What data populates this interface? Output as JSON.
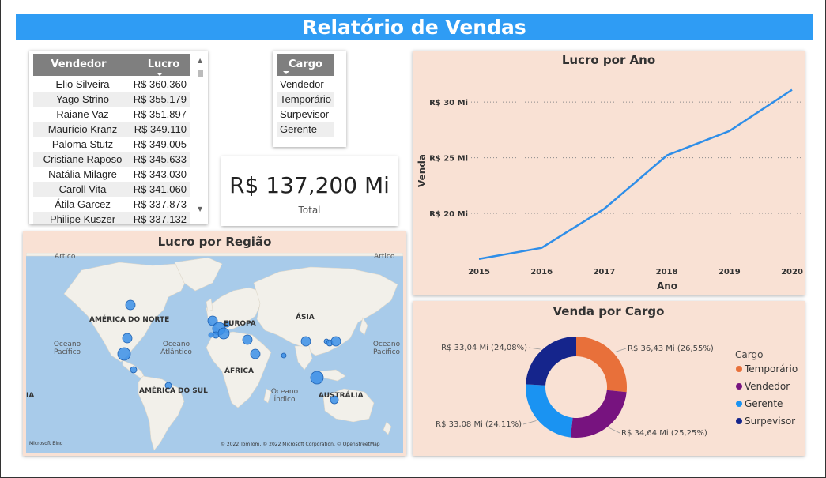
{
  "title": "Relatório de Vendas",
  "vendedor_table": {
    "headers": [
      "Vendedor",
      "Lucro"
    ],
    "rows": [
      [
        "Elio Silveira",
        "R$ 360.360"
      ],
      [
        "Yago Strino",
        "R$ 355.179"
      ],
      [
        "Raiane Vaz",
        "R$ 351.897"
      ],
      [
        "Maurício Kranz",
        "R$ 349.110"
      ],
      [
        "Paloma Stutz",
        "R$ 349.005"
      ],
      [
        "Cristiane Raposo",
        "R$ 345.633"
      ],
      [
        "Natália Milagre",
        "R$ 343.030"
      ],
      [
        "Caroll Vita",
        "R$ 341.060"
      ],
      [
        "Átila Garcez",
        "R$ 337.873"
      ],
      [
        "Philipe Kuszer",
        "R$ 337.132"
      ]
    ]
  },
  "cargo_slicer": {
    "header": "Cargo",
    "items": [
      "Vendedor",
      "Temporário",
      "Surpevisor",
      "Gerente"
    ]
  },
  "kpi": {
    "value": "R$ 137,200 Mi",
    "label": "Total"
  },
  "line_chart_title": "Lucro por Ano",
  "map": {
    "title": "Lucro por Região",
    "labels": {
      "artico1": "Ártico",
      "artico2": "Ártico",
      "america_norte": "AMÉRICA DO NORTE",
      "europa": "EUROPA",
      "asia": "ÁSIA",
      "africa": "ÁFRICA",
      "america_sul": "AMÉRICA DO SUL",
      "australia": "AUSTRÁLIA",
      "oceano_pacifico1": "Oceano Pacífico",
      "oceano_atlantico": "Oceano Atlântico",
      "oceano_indico": "Oceano Índico",
      "oceano_pacifico2": "Oceano Pacífico",
      "africa_left": "IA"
    },
    "bing": "Microsoft Bing",
    "copyright": "© 2022 TomTom, © 2022 Microsoft Corporation, © OpenStreetMap"
  },
  "donut_title": "Venda por Cargo",
  "donut_legend_title": "Cargo",
  "colors": {
    "title_bar": "#2f9cf4",
    "line": "#2f8ee8",
    "panel_bg": "#f9e1d4",
    "temporario": "#e8703a",
    "vendedor": "#77137f",
    "gerente": "#1a93f2",
    "surpevisor": "#15258c",
    "bubble": "#3b8fe8"
  },
  "chart_data": [
    {
      "type": "line",
      "title": "Lucro por Ano",
      "xlabel": "Ano",
      "ylabel": "Venda",
      "x": [
        2015,
        2016,
        2017,
        2018,
        2019,
        2020
      ],
      "series": [
        {
          "values": [
            15.9,
            16.9,
            20.4,
            25.2,
            27.4,
            31.1
          ]
        }
      ],
      "y_ticks": [
        20,
        25,
        30
      ],
      "y_tick_labels": [
        "R$ 20 Mi",
        "R$ 25 Mi",
        "R$ 30 Mi"
      ],
      "ylim": [
        15.6,
        31.5
      ],
      "grid": "horizontal dotted"
    },
    {
      "type": "pie",
      "title": "Venda por Cargo",
      "legend_title": "Cargo",
      "legend_placement": "right",
      "slices": [
        {
          "name": "Temporário",
          "value": 36.43,
          "label": "R$ 36,43 Mi (26,55%)"
        },
        {
          "name": "Vendedor",
          "value": 34.64,
          "label": "R$ 34,64 Mi (25,25%)"
        },
        {
          "name": "Gerente",
          "value": 33.08,
          "label": "R$ 33,08 Mi (24,11%)"
        },
        {
          "name": "Surpevisor",
          "value": 33.04,
          "label": "R$ 33,04 Mi (24,08%)"
        }
      ]
    }
  ]
}
